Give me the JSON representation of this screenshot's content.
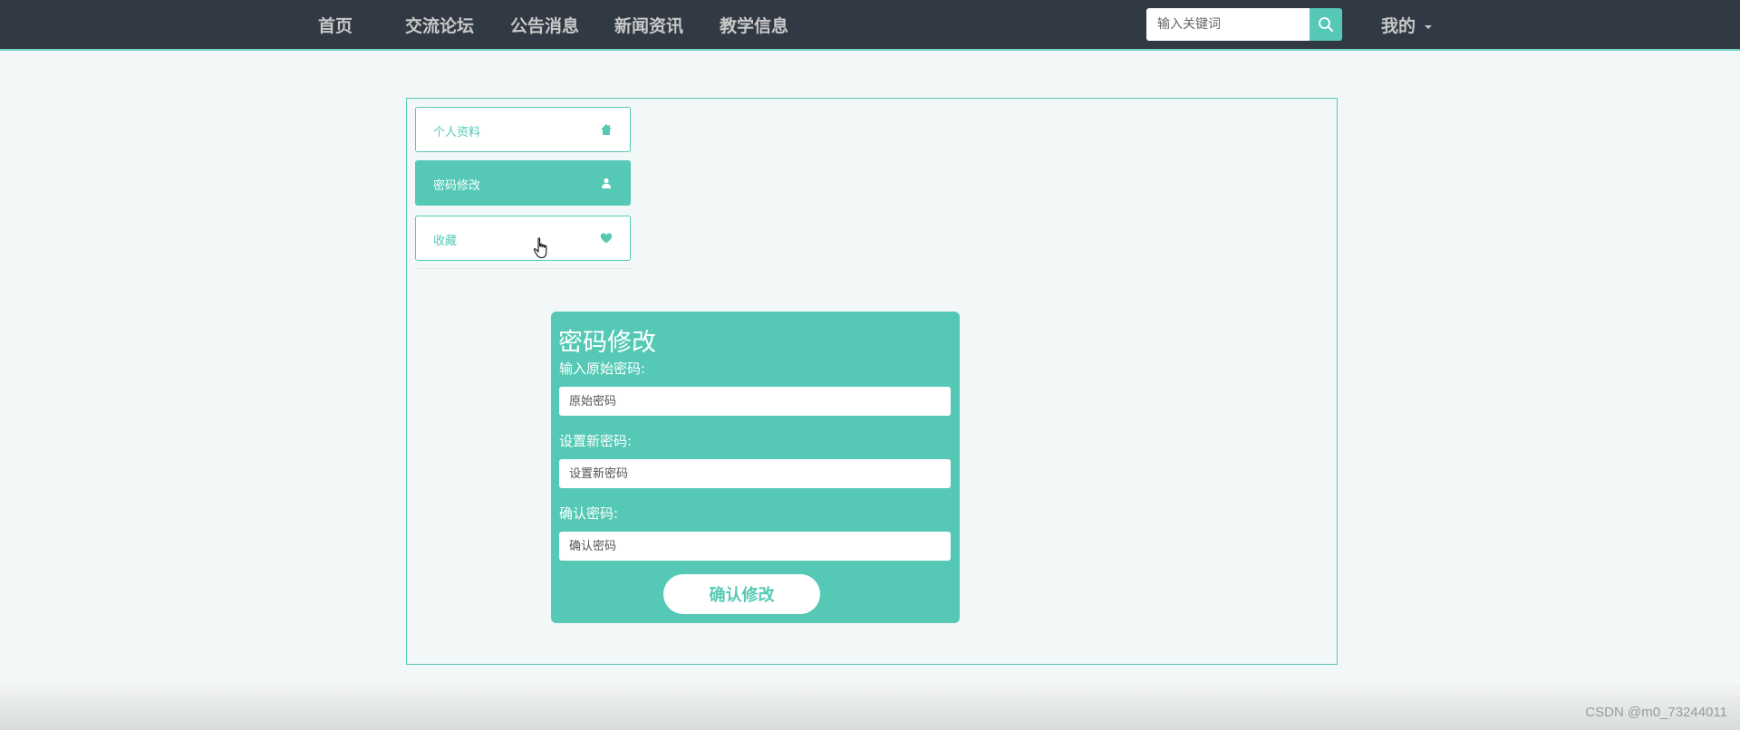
{
  "nav": {
    "items": [
      {
        "label": "首页"
      },
      {
        "label": "交流论坛"
      },
      {
        "label": "公告消息"
      },
      {
        "label": "新闻资讯"
      },
      {
        "label": "教学信息"
      }
    ],
    "search_placeholder": "输入关键词",
    "search_icon": "search-icon",
    "user_menu_label": "我的"
  },
  "sidebar": {
    "items": [
      {
        "label": "个人资料",
        "icon": "home-icon",
        "active": false
      },
      {
        "label": "密码修改",
        "icon": "user-icon",
        "active": true
      },
      {
        "label": "收藏",
        "icon": "heart-icon",
        "active": false
      }
    ]
  },
  "form": {
    "title": "密码修改",
    "old_label": "输入原始密码:",
    "old_placeholder": "原始密码",
    "new_label": "设置新密码:",
    "new_placeholder": "设置新密码",
    "confirm_label": "确认密码:",
    "confirm_placeholder": "确认密码",
    "submit_label": "确认修改"
  },
  "watermark": "CSDN @m0_73244011",
  "colors": {
    "accent": "#55c9b6",
    "navbar_bg": "#313a44",
    "page_bg": "#f2f7f7"
  }
}
